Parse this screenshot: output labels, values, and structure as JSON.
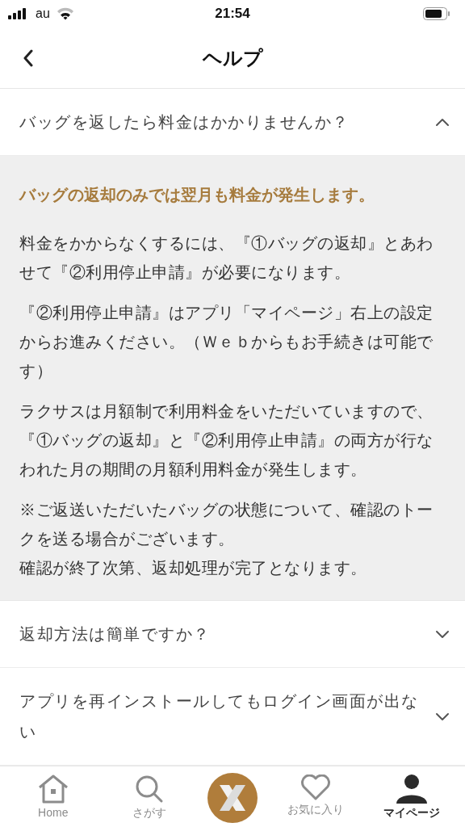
{
  "status_bar": {
    "carrier": "au",
    "time": "21:54"
  },
  "header": {
    "title": "ヘルプ"
  },
  "faq": [
    {
      "question": "バッグを返したら料金はかかりませんか？",
      "expanded": true,
      "answer": {
        "headline": "バッグの返却のみでは翌月も料金が発生します。",
        "paragraphs": [
          {
            "lines": [
              "料金をかからなくするには、『①バッグの返却』とあわせて『②利用停止申請』が必要になります。"
            ]
          },
          {
            "lines": [
              "『②利用停止申請』はアプリ「マイページ」右上の設定からお進みください。（Ｗｅｂからもお手続きは可能です）"
            ]
          },
          {
            "lines": [
              "ラクサスは月額制で利用料金をいただいていますので、『①バッグの返却』と『②利用停止申請』の両方が行なわれた月の期間の月額利用料金が発生します。"
            ]
          },
          {
            "lines": [
              "※ご返送いただいたバッグの状態について、確認のトークを送る場合がございます。",
              "確認が終了次第、返却処理が完了となります。"
            ]
          }
        ]
      }
    },
    {
      "question": "返却方法は簡単ですか？",
      "expanded": false
    },
    {
      "question": "アプリを再インストールしてもログイン画面が出ない",
      "expanded": false
    }
  ],
  "tab_bar": [
    {
      "kind": "home",
      "label": "Home",
      "selected": false
    },
    {
      "kind": "search",
      "label": "さがす",
      "selected": false
    },
    {
      "kind": "logo",
      "selected": false
    },
    {
      "kind": "favorite",
      "label": "お気に入り",
      "selected": false
    },
    {
      "kind": "mypage",
      "label": "マイページ",
      "selected": true
    }
  ]
}
